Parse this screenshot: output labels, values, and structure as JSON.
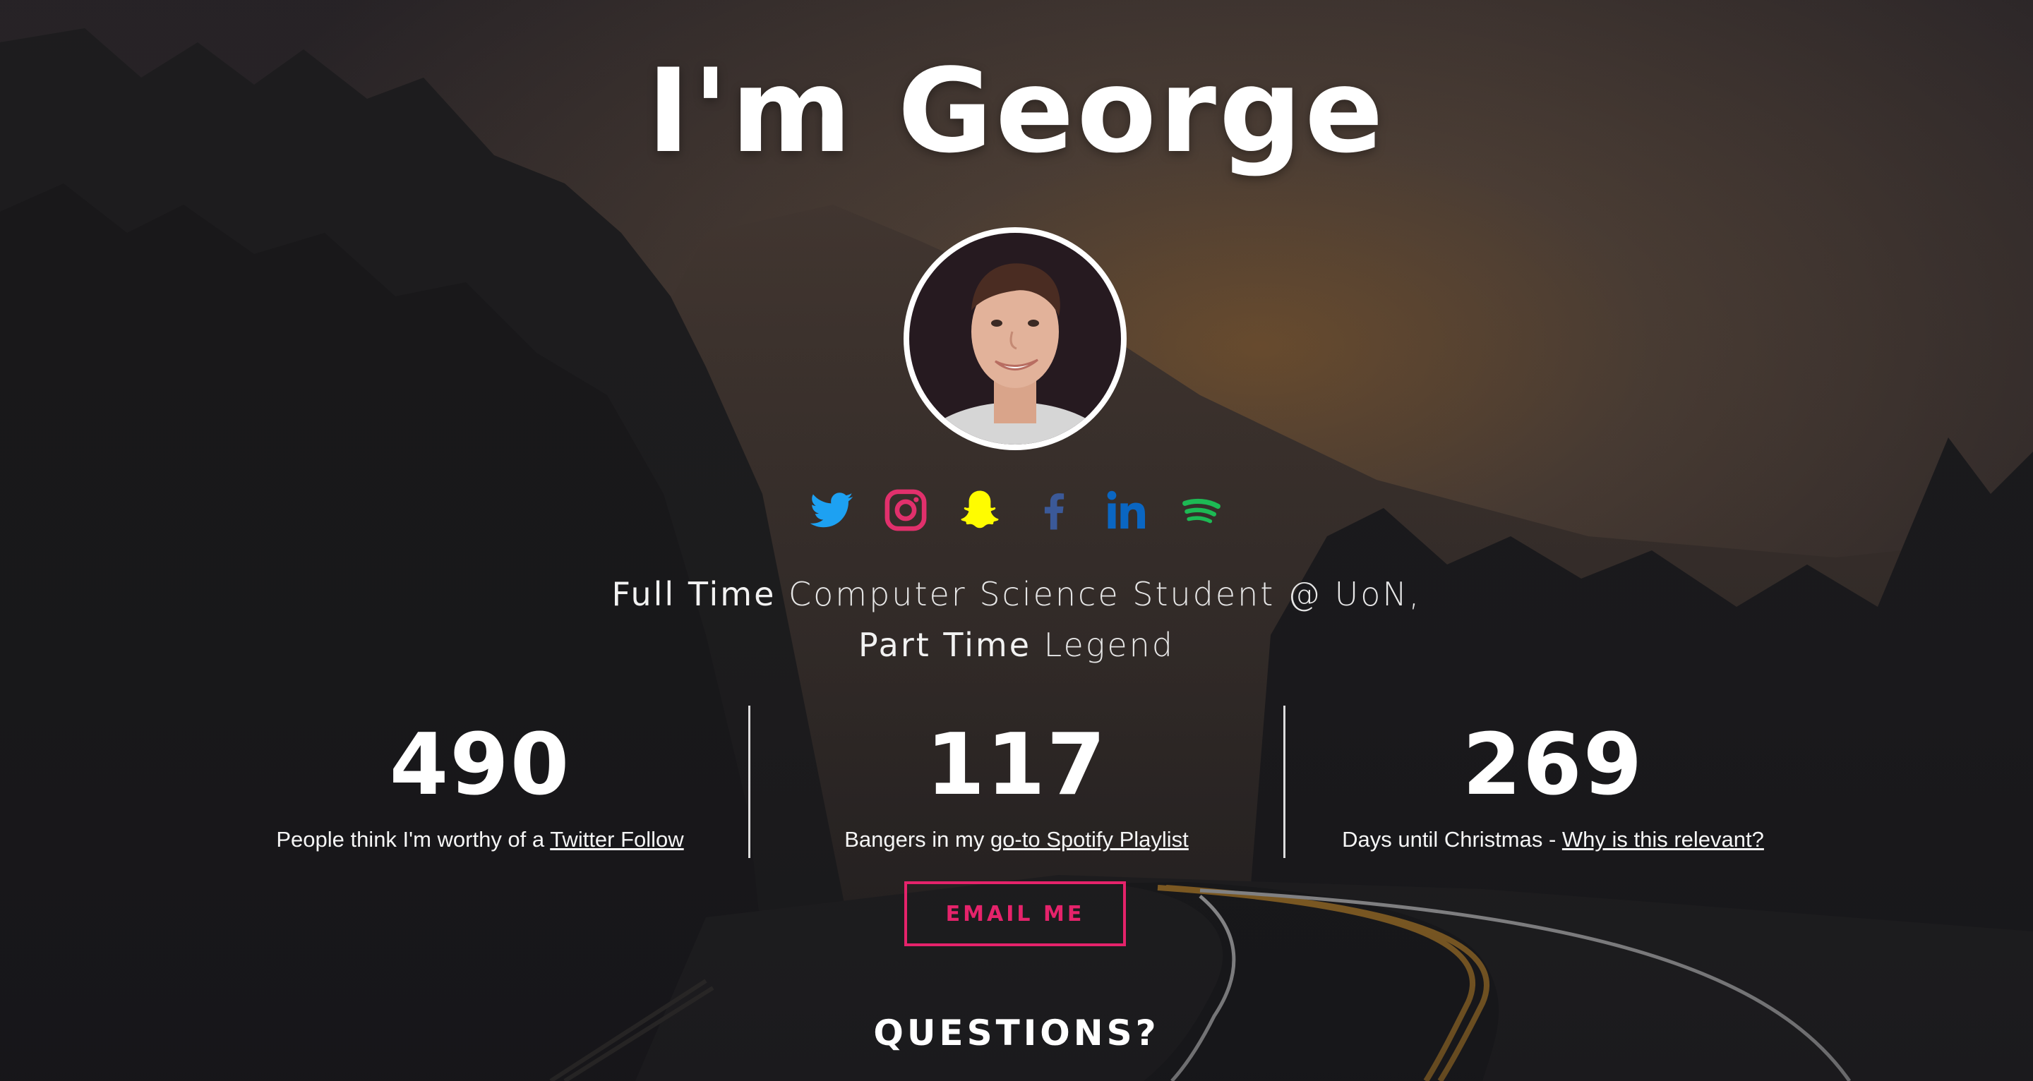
{
  "hero": {
    "title": "I'm George",
    "avatar_alt": "George"
  },
  "socials": [
    {
      "name": "twitter-icon",
      "color": "#1da1f2"
    },
    {
      "name": "instagram-icon",
      "color": "#e1306c"
    },
    {
      "name": "snapchat-icon",
      "color": "#fffc00"
    },
    {
      "name": "facebook-icon",
      "color": "#3b5998"
    },
    {
      "name": "linkedin-icon",
      "color": "#0a66c2"
    },
    {
      "name": "spotify-icon",
      "color": "#1db954"
    }
  ],
  "tagline": {
    "line1_a": "Full Time",
    "line1_b": " Computer Science Student @ UoN,",
    "line2_a": "Part Time",
    "line2_b": " Legend"
  },
  "stats": [
    {
      "number": "490",
      "caption": "People think I'm worthy of a ",
      "link": "Twitter Follow"
    },
    {
      "number": "117",
      "caption": "Bangers in my ",
      "link": "go-to Spotify Playlist"
    },
    {
      "number": "269",
      "caption": "Days until Christmas - ",
      "link": "Why is this relevant?"
    }
  ],
  "buttons": {
    "email": "EMAIL ME"
  },
  "sections": {
    "questions": "QUESTIONS?"
  },
  "colors": {
    "accent": "#e5236b",
    "text": "#ffffff"
  }
}
